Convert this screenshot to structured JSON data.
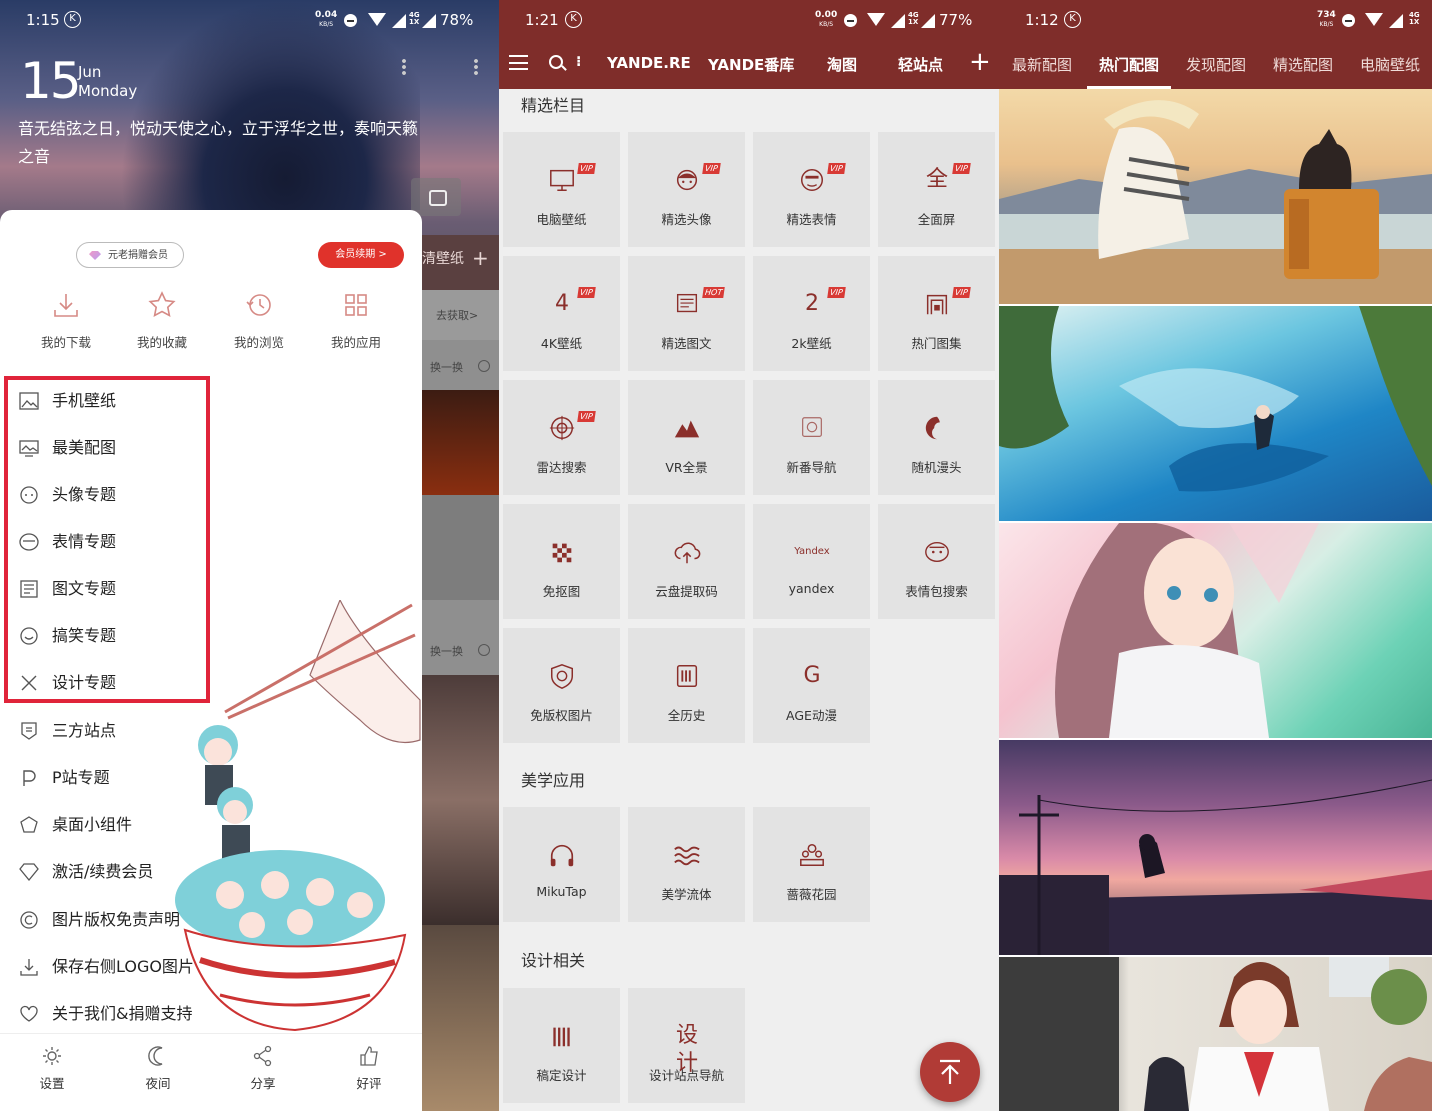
{
  "panel1": {
    "status": {
      "time": "1:15",
      "kbs_value": "0.04",
      "kbs_unit": "KB/S",
      "network": "4G",
      "sim": "1X",
      "battery": "78%"
    },
    "date": {
      "day": "15",
      "month": "Jun",
      "weekday": "Monday"
    },
    "quote": "音无结弦之日，悦动天使之心，立于浮华之世，奏响天籁之音",
    "member_label": "元老捐赠会员",
    "renew_label": "会员续期 >",
    "quick_actions": [
      "我的下载",
      "我的收藏",
      "我的浏览",
      "我的应用"
    ],
    "menu": [
      "手机壁纸",
      "最美配图",
      "头像专题",
      "表情专题",
      "图文专题",
      "搞笑专题",
      "设计专题",
      "三方站点",
      "P站专题",
      "桌面小组件",
      "激活/续费会员",
      "图片版权免责声明",
      "保存右侧LOGO图片",
      "关于我们&捐赠支持"
    ],
    "bottom_nav": [
      "设置",
      "夜间",
      "分享",
      "好评"
    ],
    "background_strip": {
      "tab_fragment": "清壁纸",
      "get_label": "去获取>",
      "swap_label_1": "换一换",
      "swap_label_2": "换一换"
    }
  },
  "panel2": {
    "status": {
      "time": "1:21",
      "kbs_value": "0.00",
      "kbs_unit": "KB/S",
      "network": "4G",
      "sim": "1X",
      "battery": "77%"
    },
    "tabs": [
      "YANDE.RE",
      "YANDE番库",
      "淘图",
      "轻站点"
    ],
    "sections": [
      {
        "title": "精选栏目",
        "items": [
          {
            "label": "电脑壁纸",
            "icon": "monitor-icon",
            "badge": "VIP"
          },
          {
            "label": "精选头像",
            "icon": "avatar-face-icon",
            "badge": "VIP"
          },
          {
            "label": "精选表情",
            "icon": "emoji-face-icon",
            "badge": "VIP"
          },
          {
            "label": "全面屏",
            "icon": "fullscreen-glyph-icon",
            "glyph": "全",
            "badge": "VIP"
          },
          {
            "label": "4K壁纸",
            "icon": "4k-glyph-icon",
            "glyph": "4",
            "badge": "VIP"
          },
          {
            "label": "精选图文",
            "icon": "picture-text-icon",
            "badge": "HOT"
          },
          {
            "label": "2k壁纸",
            "icon": "2k-glyph-icon",
            "glyph": "2",
            "badge": "VIP"
          },
          {
            "label": "热门图集",
            "icon": "gallery-icon",
            "badge": "VIP"
          },
          {
            "label": "雷达搜索",
            "icon": "radar-icon",
            "badge": "VIP"
          },
          {
            "label": "VR全景",
            "icon": "mountain-icon",
            "badge": ""
          },
          {
            "label": "新番导航",
            "icon": "anime-nav-icon",
            "badge": ""
          },
          {
            "label": "随机漫头",
            "icon": "random-head-icon",
            "badge": ""
          },
          {
            "label": "免抠图",
            "icon": "checker-icon",
            "badge": ""
          },
          {
            "label": "云盘提取码",
            "icon": "cloud-upload-icon",
            "badge": ""
          },
          {
            "label": "yandex",
            "icon": "yandex-logo-icon",
            "glyph": "Yandex",
            "badge": ""
          },
          {
            "label": "表情包搜索",
            "icon": "sticker-face-icon",
            "badge": ""
          },
          {
            "label": "免版权图片",
            "icon": "copyright-shield-icon",
            "badge": ""
          },
          {
            "label": "全历史",
            "icon": "history-book-icon",
            "badge": ""
          },
          {
            "label": "AGE动漫",
            "icon": "age-logo-icon",
            "glyph": "G",
            "badge": ""
          }
        ]
      },
      {
        "title": "美学应用",
        "items": [
          {
            "label": "MikuTap",
            "icon": "headphones-icon",
            "badge": ""
          },
          {
            "label": "美学流体",
            "icon": "waves-icon",
            "badge": ""
          },
          {
            "label": "蔷薇花园",
            "icon": "garden-icon",
            "badge": ""
          }
        ]
      },
      {
        "title": "设计相关",
        "items": [
          {
            "label": "稿定设计",
            "icon": "design-tools-icon",
            "badge": ""
          },
          {
            "label": "设计站点导航",
            "icon": "design-text-icon",
            "glyph": "设计",
            "badge": ""
          }
        ]
      }
    ]
  },
  "panel3": {
    "status": {
      "time": "1:12",
      "kbs_value": "734",
      "kbs_unit": "KB/S",
      "network": "4G",
      "sim": "1X"
    },
    "tabs": [
      "最新配图",
      "热门配图",
      "发现配图",
      "精选配图",
      "电脑壁纸"
    ],
    "active_tab": "热门配图",
    "images": [
      "anime-girl-with-cat-on-suitcase",
      "anime-girl-underwater",
      "anime-girl-with-flower-petals",
      "anime-girl-sitting-at-sunset",
      "anime-girl-with-cat-classroom"
    ]
  },
  "colors": {
    "brand": "#7f2d2a",
    "accent_red": "#e0322b",
    "tile_bg": "#e3e3e3",
    "highlight_box": "#e0243a"
  }
}
